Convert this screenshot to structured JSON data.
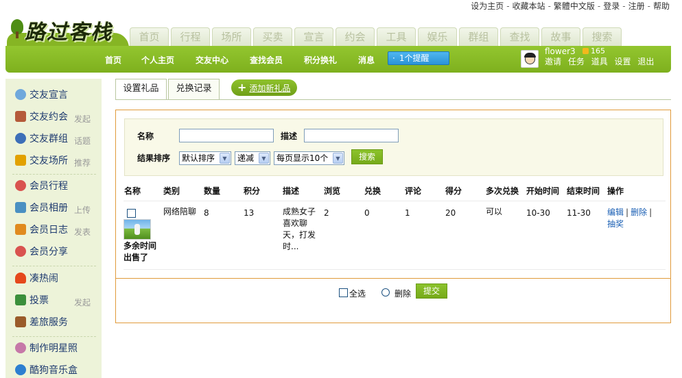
{
  "top_links": [
    "设为主页",
    "收藏本站",
    "繁體中文版",
    "登录",
    "注册",
    "帮助"
  ],
  "logo_text": "路过客栈",
  "category_tabs": [
    "首页",
    "行程",
    "场所",
    "买卖",
    "宣言",
    "约会",
    "工具",
    "娱乐",
    "群组",
    "查找",
    "故事",
    "搜索"
  ],
  "nav": {
    "items": [
      "首页",
      "个人主页",
      "交友中心",
      "查找会员",
      "积分换礼",
      "消息"
    ],
    "notification": "1个提醒",
    "user": {
      "name": "flower3",
      "points": "165",
      "links": [
        "邀请",
        "任务",
        "道具",
        "设置",
        "退出"
      ]
    }
  },
  "sidebar": {
    "items": [
      {
        "label": "交友宣言",
        "sub": "",
        "icon": "speech-bubble-icon",
        "color": "#6fa8dc"
      },
      {
        "label": "交友约会",
        "sub": "发起",
        "icon": "calendar-icon",
        "color": "#b55a3a"
      },
      {
        "label": "交友群组",
        "sub": "话题",
        "icon": "group-icon",
        "color": "#3d6fb8"
      },
      {
        "label": "交友场所",
        "sub": "推荐",
        "icon": "place-icon",
        "color": "#e2a100"
      },
      {
        "label": "会员行程",
        "sub": "",
        "icon": "heart-icon",
        "color": "#d9534f"
      },
      {
        "label": "会员相册",
        "sub": "上传",
        "icon": "photo-icon",
        "color": "#4a90c2"
      },
      {
        "label": "会员日志",
        "sub": "发表",
        "icon": "journal-icon",
        "color": "#e08a1e"
      },
      {
        "label": "会员分享",
        "sub": "",
        "icon": "share-heart-icon",
        "color": "#d9534f"
      },
      {
        "label": "凑热闹",
        "sub": "",
        "icon": "fire-icon",
        "color": "#e5481c"
      },
      {
        "label": "投票",
        "sub": "发起",
        "icon": "bar-chart-icon",
        "color": "#3b8f3b"
      },
      {
        "label": "差旅服务",
        "sub": "",
        "icon": "luggage-icon",
        "color": "#9a5b2a"
      },
      {
        "label": "制作明星照",
        "sub": "",
        "icon": "star-face-icon",
        "color": "#c678a8"
      },
      {
        "label": "酷狗音乐盒",
        "sub": "",
        "icon": "music-icon",
        "color": "#2c7fd0"
      }
    ]
  },
  "tabs": [
    "设置礼品",
    "兑换记录"
  ],
  "add_gift": "添加新礼品",
  "filter": {
    "name_label": "名称",
    "desc_label": "描述",
    "name_value": "",
    "desc_value": "",
    "sort_label": "结果排序",
    "sort_field": "默认排序",
    "sort_order": "递减",
    "per_page": "每页显示10个",
    "search_button": "搜索"
  },
  "table": {
    "headers": [
      "名称",
      "类别",
      "数量",
      "积分",
      "描述",
      "浏览",
      "兑换",
      "评论",
      "得分",
      "多次兑换",
      "开始时间",
      "结束时间",
      "操作"
    ],
    "rows": [
      {
        "name": "多余时间出售了",
        "category": "网络陪聊",
        "quantity": "8",
        "points": "13",
        "description": "成熟女子喜欢聊天，打发时...",
        "views": "2",
        "exchanges": "0",
        "comments": "1",
        "score": "20",
        "multiple": "可以",
        "start": "10-30",
        "end": "11-30",
        "actions": [
          "编辑",
          "删除",
          "抽奖"
        ]
      }
    ]
  },
  "footer": {
    "select_all": "全选",
    "delete": "删除",
    "submit": "提交"
  }
}
